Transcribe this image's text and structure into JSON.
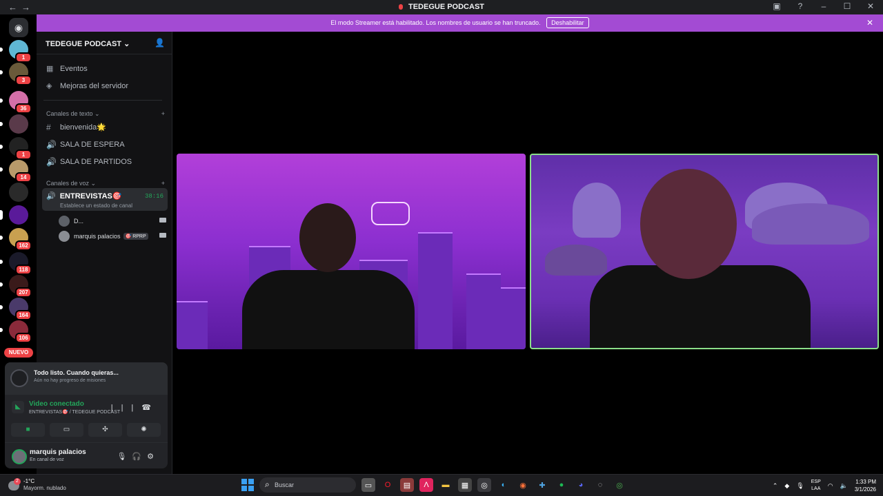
{
  "titlebar": {
    "title": "TEDEGUE PODCAST"
  },
  "streamer_banner": {
    "message": "El modo Streamer está habilitado. Los nombres de usuario se han truncado.",
    "button": "Deshabilitar"
  },
  "guilds": [
    {
      "badge": "1"
    },
    {
      "badge": "3"
    },
    {
      "badge": "36"
    },
    {
      "badge": ""
    },
    {
      "badge": "1"
    },
    {
      "badge": "14"
    },
    {
      "badge": ""
    },
    {
      "badge": ""
    },
    {
      "badge": "162"
    },
    {
      "badge": "118"
    },
    {
      "badge": "207"
    },
    {
      "badge": "164"
    },
    {
      "badge": "106"
    }
  ],
  "nuevo_label": "NUEVO",
  "sidebar": {
    "server_name": "TEDEGUE PODCAST",
    "events": "Eventos",
    "boosts": "Mejoras del servidor",
    "text_category": "Canales de texto",
    "text_channels": [
      "bienvenida🌟",
      "SALA DE ESPERA",
      "SALA DE PARTIDOS"
    ],
    "voice_category": "Canales de voz",
    "active_voice": {
      "name": "ENTREVISTAS🎯",
      "timer": "38:16",
      "status": "Establece un estado de canal"
    },
    "voice_users": [
      {
        "name": "D...",
        "tag": ""
      },
      {
        "name": "marquis palacios",
        "tag": "🎯 RPRP"
      }
    ]
  },
  "panel": {
    "quest_title": "Todo listo. Cuando quieras...",
    "quest_sub": "Aún no hay progreso de misiones",
    "conn_status": "Video conectado",
    "conn_channel": "ENTREVISTAS🎯 / TEDEGUE PODCAST",
    "user_name": "marquis palacios",
    "user_status": "En canal de voz"
  },
  "taskbar": {
    "temp": "-1°C",
    "weather": "Mayorm. nublado",
    "weather_badge": "2",
    "search_placeholder": "Buscar",
    "lang1": "ESP",
    "lang2": "LAA",
    "time": "1:33 PM",
    "date": "3/1/2026"
  },
  "colors": {
    "accent": "#a34bd3",
    "online": "#23a55a",
    "danger": "#ed4245"
  }
}
